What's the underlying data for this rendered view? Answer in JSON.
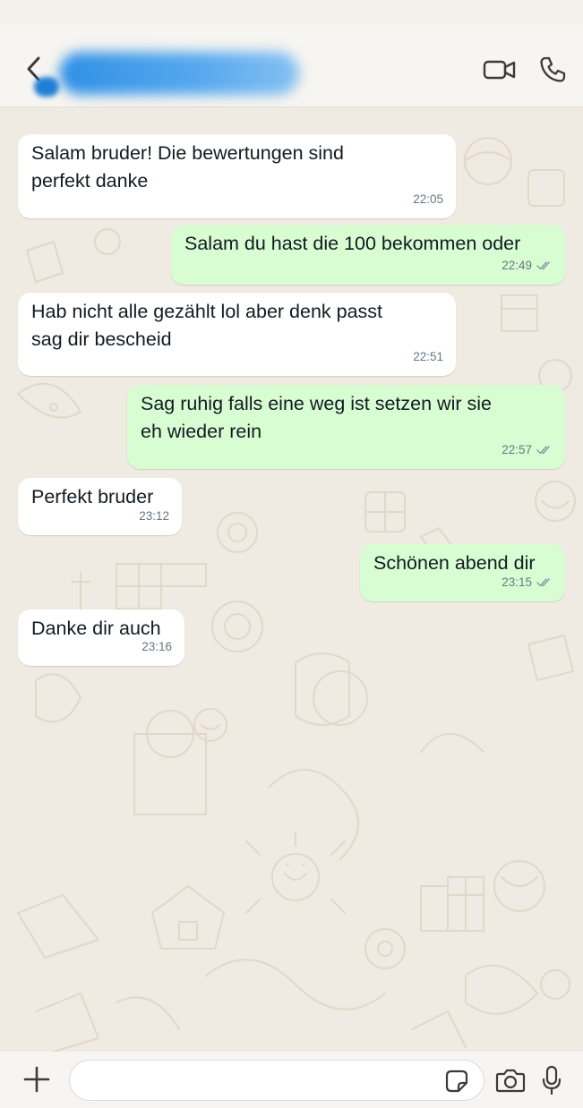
{
  "header": {
    "contact_name": "",
    "icons": {
      "back": "chevron-left-icon",
      "video": "video-camera-icon",
      "call": "phone-icon"
    }
  },
  "messages": [
    {
      "direction": "in",
      "text": "Salam bruder! Die bewertungen sind\nperfekt danke",
      "time": "22:05"
    },
    {
      "direction": "out",
      "text": "Salam du hast die 100 bekommen oder",
      "time": "22:49",
      "status": "read"
    },
    {
      "direction": "in",
      "text": "Hab nicht alle gezählt lol aber denk passt\nsag dir bescheid",
      "time": "22:51"
    },
    {
      "direction": "out",
      "text": "Sag ruhig falls eine weg ist setzen wir sie\neh wieder rein",
      "time": "22:57",
      "status": "read"
    },
    {
      "direction": "in",
      "text": "Perfekt bruder",
      "time": "23:12"
    },
    {
      "direction": "out",
      "text": "Schönen abend dir",
      "time": "23:15",
      "status": "read"
    },
    {
      "direction": "in",
      "text": "Danke dir auch",
      "time": "23:16"
    }
  ],
  "composer": {
    "value": "",
    "placeholder": "",
    "icons": {
      "add": "plus-icon",
      "sticker": "sticker-icon",
      "camera": "camera-icon",
      "mic": "microphone-icon"
    }
  },
  "colors": {
    "incoming_bubble": "#ffffff",
    "outgoing_bubble": "#d9fdd3",
    "chat_background": "#efeae2",
    "header_background": "#f7f5f1",
    "meta_text": "#667781",
    "read_ticks": "#8696a0"
  }
}
